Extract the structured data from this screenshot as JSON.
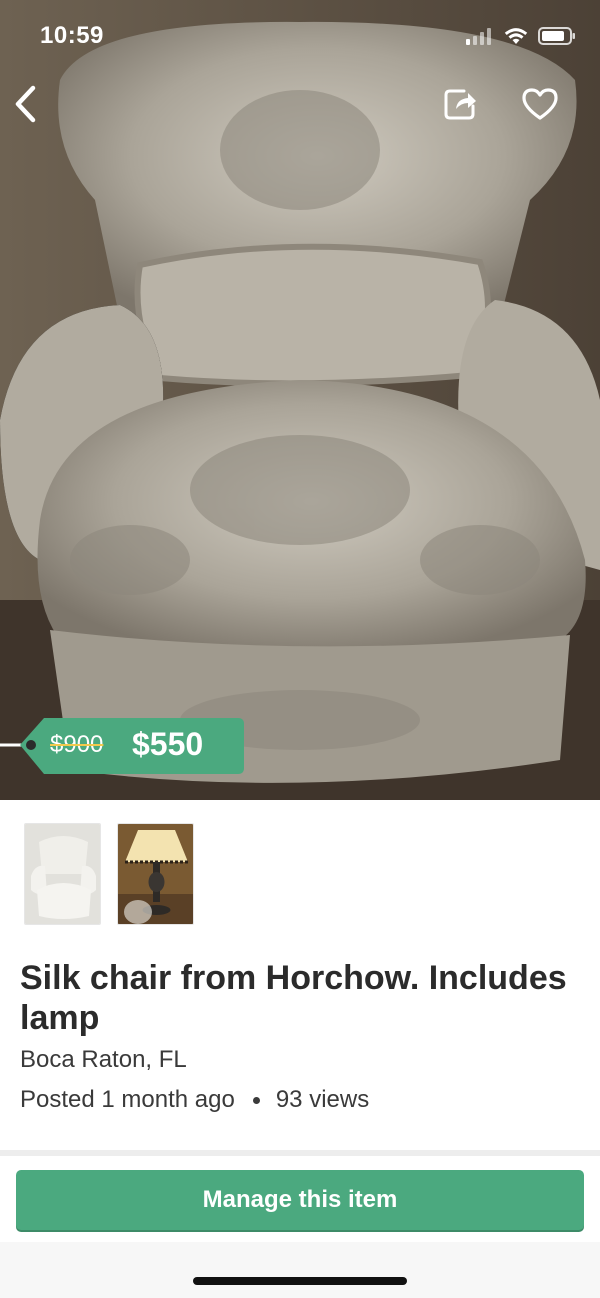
{
  "status_bar": {
    "time": "10:59",
    "icons": [
      "cellular-signal-icon",
      "wifi-icon",
      "battery-icon"
    ]
  },
  "header": {
    "back_icon": "chevron-left-icon",
    "share_icon": "share-icon",
    "favorite_icon": "heart-icon"
  },
  "listing": {
    "original_price": "$900",
    "price": "$550",
    "title": "Silk chair from Horchow. Includes lamp",
    "location": "Boca Raton, FL",
    "posted": "Posted 1 month ago",
    "views": "93 views",
    "thumbnails": [
      "chair photo",
      "lamp photo"
    ]
  },
  "actions": {
    "manage_label": "Manage this item"
  },
  "colors": {
    "accent": "#4ba97f",
    "price_strike": "#f2c94c"
  }
}
